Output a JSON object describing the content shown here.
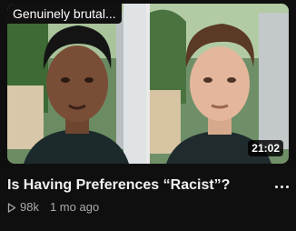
{
  "thumbnail": {
    "overlay_text": "Genuinely brutal...",
    "duration": "21:02"
  },
  "video": {
    "title": "Is Having Preferences “Racist”?",
    "views": "98k",
    "age": "1 mo ago"
  },
  "icons": {
    "views": "play-outline-icon",
    "menu": "more-vert-icon"
  },
  "colors": {
    "background": "#0f0f0f",
    "title": "#f1f1f1",
    "meta": "#aaaaaa",
    "divider": "#e9e9e9"
  }
}
